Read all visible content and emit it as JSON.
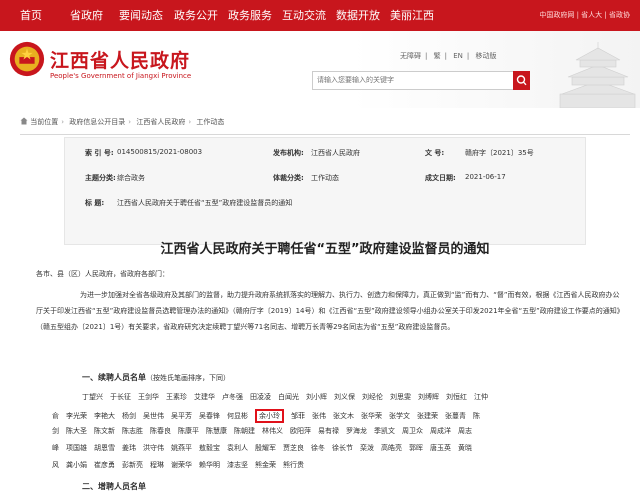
{
  "top_nav": {
    "items": [
      "首页",
      "省政府",
      "要闻动态",
      "政务公开",
      "政务服务",
      "互动交流",
      "数据开放",
      "美丽江西"
    ],
    "right_links": "中国政府网 | 省人大 | 省政协"
  },
  "header": {
    "title": "江西省人民政府",
    "subtitle": "People's Government of Jiangxi Province",
    "links": [
      "无障碍",
      "繁",
      "EN",
      "移动版"
    ],
    "search_placeholder": "请输入您要输入的关键字"
  },
  "breadcrumb": [
    "当前位置",
    "政府信息公开目录",
    "江西省人民政府",
    "工作动态"
  ],
  "meta": {
    "index_label": "索 引 号:",
    "index_value": "014500815/2021-08003",
    "publisher_label": "发布机构:",
    "publisher_value": "江西省人民政府",
    "docno_label": "文    号:",
    "docno_value": "赣府字〔2021〕35号",
    "category_label": "主题分类:",
    "category_value": "综合政务",
    "type_label": "体裁分类:",
    "type_value": "工作动态",
    "date_label": "成文日期:",
    "date_value": "2021-06-17",
    "title_label": "标    题:",
    "title_value": "江西省人民政府关于聘任省“五型”政府建设监督员的通知"
  },
  "document": {
    "title": "江西省人民政府关于聘任省“五型”政府建设监督员的通知",
    "salutation": "各市、县（区）人民政府，省政府各部门：",
    "para1": "为进一步加强对全省各级政府及其部门的监督，助力提升政府系统抓落实的理解力、执行力、创造力和保障力，真正做到“监”而有力、“督”而有效，根据《江西省人民政府办公厅关于印发江西省“五型”政府建设监督员选聘管理办法的通知》（赣府厅字〔2019〕14号）和《江西省“五型”政府建设领导小组办公室关于印发2021年全省“五型”政府建设工作要点的通知》（赣五型组办〔2021〕1号）有关要求，省政府研究决定续聘丁望兴等71名同志、增聘万长青等29名同志为省“五型”政府建设监督员。",
    "section1_title": "一、续聘人员名单",
    "section1_note": "（按姓氏笔画排序，下同）",
    "names_row1": [
      "丁望兴",
      "于长征",
      "王剑华",
      "王素珍",
      "艾建华",
      "卢冬强",
      "田凌凌",
      "白闻光",
      "刘小辉",
      "刘义保",
      "刘经伦",
      "刘思雯",
      "刘缚辉",
      "刘恒红",
      "江仲"
    ],
    "names_row2": [
      "俞",
      "李光荣",
      "李艳大",
      "杨剑",
      "吴世伟",
      "吴平芳",
      "吴春锋",
      "何显彬"
    ],
    "highlighted_name": "余小玲",
    "names_row2b": [
      "邹菲",
      "张伟",
      "张文木",
      "张华荣",
      "张学文",
      "张建荣",
      "张蔓青",
      "陈"
    ],
    "names_row3": [
      "剑",
      "陈大圣",
      "陈文新",
      "陈志胜",
      "陈春良",
      "陈康平",
      "陈慧康",
      "陈朝建",
      "林伟义",
      "欧阳萍",
      "易有禄",
      "罗海龙",
      "季凯文",
      "周卫众",
      "周成洋",
      "周志"
    ],
    "names_row4": [
      "峰",
      "项国雄",
      "胡恩雪",
      "姜玮",
      "洪守伟",
      "姚燕平",
      "敖毅宝",
      "袁利人",
      "殷耀军",
      "贾芝良",
      "徐冬",
      "徐长节",
      "栾泼",
      "高皓亮",
      "郭晖",
      "唐玉英",
      "黄晓"
    ],
    "names_row5": [
      "风",
      "龚小娟",
      "崔彦勇",
      "彭新亮",
      "程琳",
      "谢荣华",
      "赖华明",
      "漆志坚",
      "熊金荣",
      "熊行贵"
    ],
    "section2_title": "二、增聘人员名单"
  }
}
